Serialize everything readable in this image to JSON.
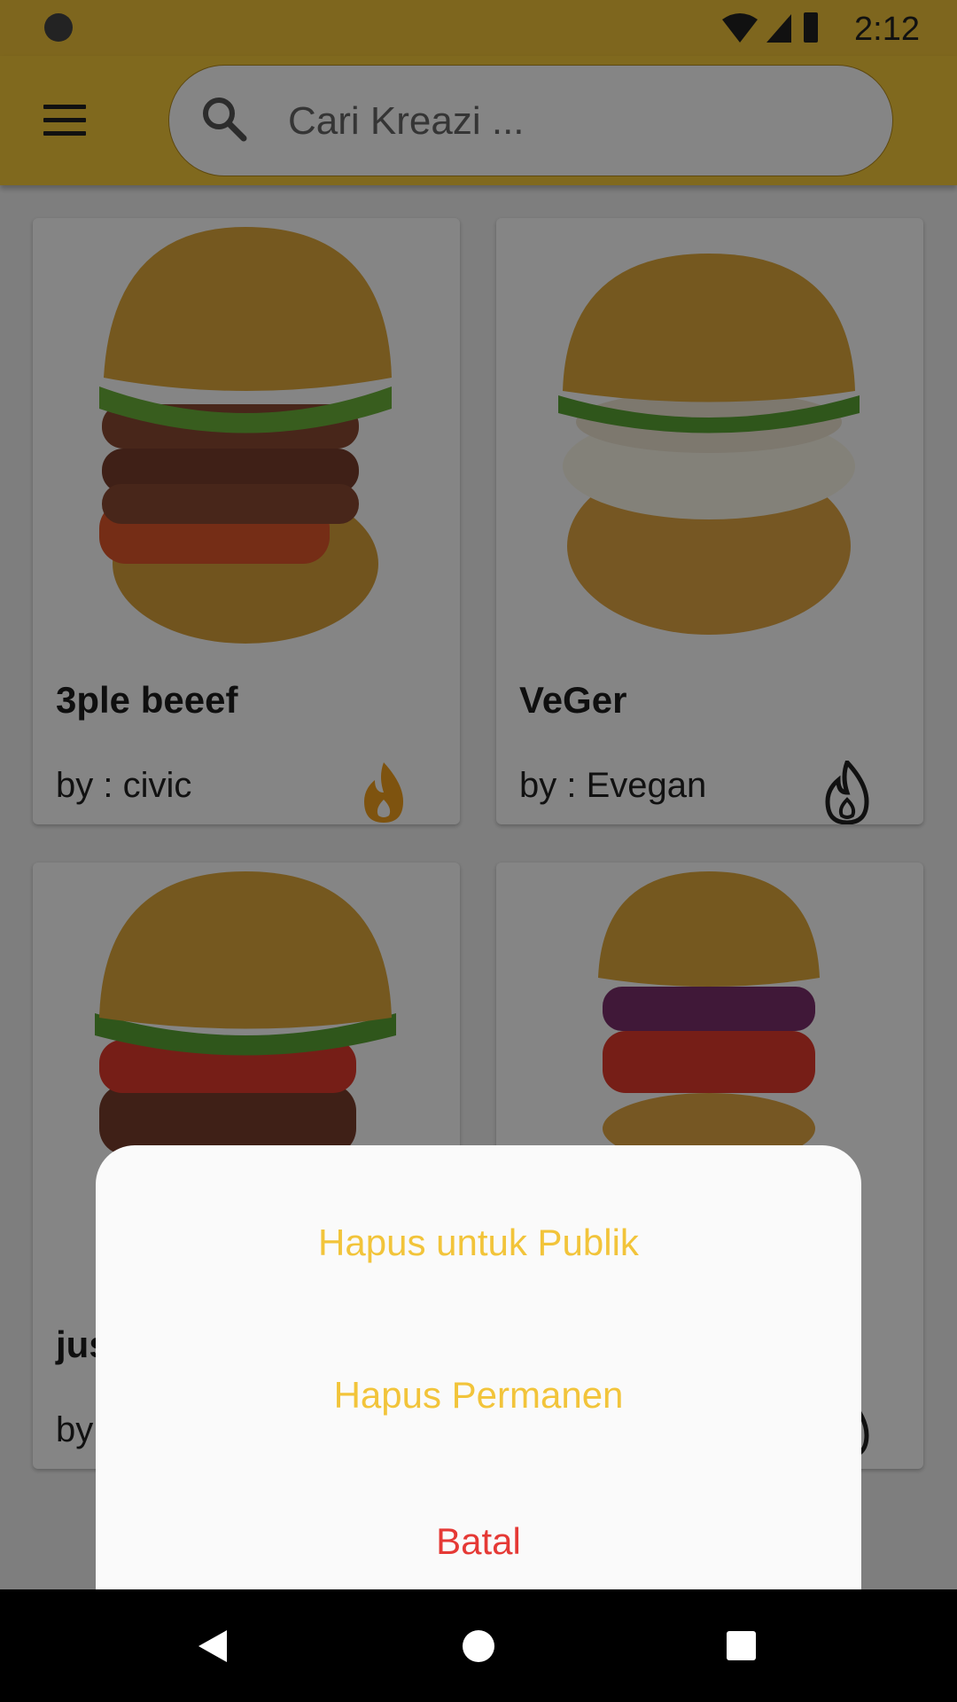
{
  "status_bar": {
    "time": "2:12"
  },
  "search": {
    "placeholder": "Cari Kreazi ..."
  },
  "cards": [
    {
      "title": "3ple beeef",
      "author": "by : civic",
      "fire_color": "#f2a01e"
    },
    {
      "title": "VeGer",
      "author": "by : Evegan",
      "fire_color": "#222222"
    },
    {
      "title": "jus",
      "author": "by",
      "fire_color": "#222222"
    },
    {
      "title": "",
      "author": "",
      "fire_color": "#222222"
    }
  ],
  "sheet": {
    "option_public": "Hapus untuk Publik",
    "option_permanent": "Hapus Permanen",
    "option_cancel": "Batal",
    "colors": {
      "option": "#f2c43a",
      "cancel": "#e53935"
    }
  },
  "colors": {
    "appbar": "#f6c93b",
    "accent": "#f2a01e"
  }
}
